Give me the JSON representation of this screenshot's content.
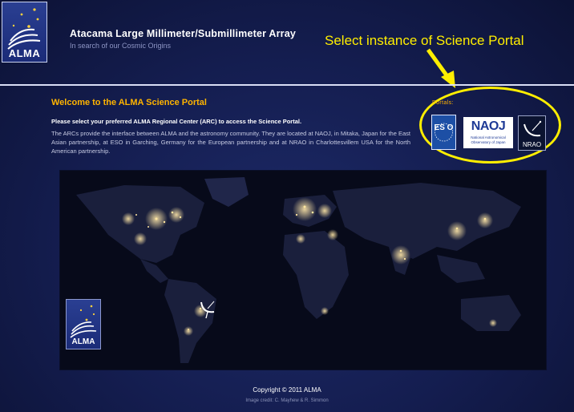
{
  "header": {
    "logo_text": "ALMA",
    "title": "Atacama Large Millimeter/Submillimeter Array",
    "subtitle": "In search of our Cosmic Origins"
  },
  "annotation": {
    "text": "Select instance of Science Portal",
    "color": "#ffee00"
  },
  "main": {
    "welcome": "Welcome to the ALMA Science Portal",
    "instruction": "Please select your preferred ALMA Regional Center (ARC) to access the Science Portal.",
    "description": "The ARCs provide the interface between ALMA and the astronomy community. They are located at NAOJ, in Mitaka, Japan for the East Asian partnership, at ESO in Garching, Germany for the European partnership and at NRAO in Charlottesvillem USA for the North American partnership."
  },
  "portals": {
    "label": "Portals:",
    "items": [
      {
        "id": "eso",
        "logo_text": "ES O"
      },
      {
        "id": "naoj",
        "logo_text": "NAOJ",
        "sub_text": "National Astronomical Observatory of Japan"
      },
      {
        "id": "nrao",
        "logo_text": "NRAO"
      }
    ]
  },
  "map": {
    "logo_text": "ALMA"
  },
  "footer": {
    "copyright": "Copyright © 2011 ALMA",
    "credit": "Image credit: C. Mayhew & R. Simmon"
  },
  "colors": {
    "accent_orange": "#ffb400",
    "annotation_yellow": "#ffee00",
    "background": "#141d4f"
  }
}
